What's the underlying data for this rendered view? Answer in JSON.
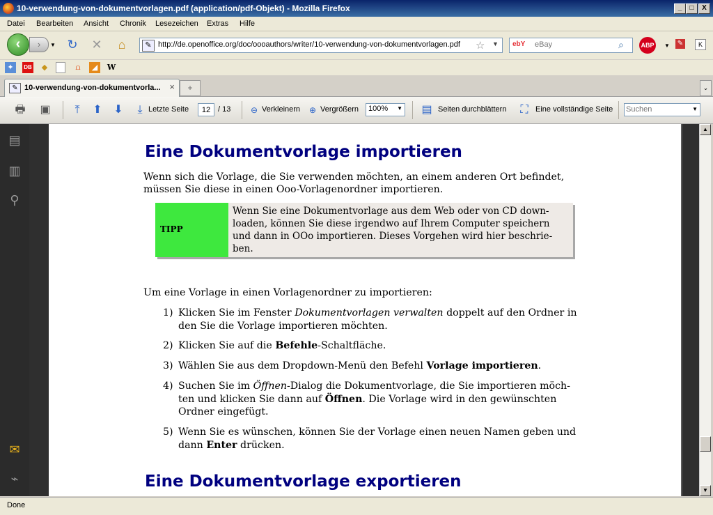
{
  "window": {
    "title": "10-verwendung-von-dokumentvorlagen.pdf (application/pdf-Objekt) - Mozilla Firefox",
    "controls": [
      "_",
      "□",
      "X"
    ]
  },
  "menu": [
    "Datei",
    "Bearbeiten",
    "Ansicht",
    "Chronik",
    "Lesezeichen",
    "Extras",
    "Hilfe"
  ],
  "nav": {
    "url": "http://de.openoffice.org/doc/oooauthors/writer/10-verwendung-von-dokumentvorlagen.pdf",
    "search_engine": "ebY",
    "search_placeholder": "eBay",
    "abp_label": "ABP"
  },
  "tabs": {
    "active_label": "10-verwendung-von-dokumentvorla...",
    "close": "×",
    "new_tab": "+"
  },
  "pdf_toolbar": {
    "last_page": "Letzte Seite",
    "current_page": "12",
    "total_pages": "/ 13",
    "zoom_out": "Verkleinern",
    "zoom_in": "Vergrößern",
    "zoom_value": "100%",
    "browse_pages": "Seiten durchblättern",
    "full_page": "Eine vollständige Seite",
    "search_placeholder": "Suchen"
  },
  "document": {
    "heading1": "Eine Dokumentvorlage importieren",
    "intro_line1": "Wenn sich die Vorlage, die Sie verwenden möchten, an einem anderen Ort befindet,",
    "intro_line2": "müssen Sie diese in einen Ooo-Vorlagenordner importieren.",
    "tip_label": "TIPP",
    "tip_line1": "Wenn Sie eine Dokumentvorlage aus dem Web oder von CD down-",
    "tip_line2": "loaden, können Sie diese irgendwo auf Ihrem Computer speichern",
    "tip_line3": "und dann in OOo importieren. Dieses Vorgehen wird hier beschrie-",
    "tip_line4": "ben.",
    "steps_intro": "Um eine Vorlage in einen Vorlagenordner zu importieren:",
    "steps": [
      {
        "num": "1)",
        "a": "Klicken Sie im Fenster ",
        "em": "Dokumentvorlagen verwalten",
        "b": " doppelt auf den Ordner in",
        "line2": "den Sie die Vorlage importieren möchten."
      },
      {
        "num": "2)",
        "a": "Klicken Sie auf die ",
        "strong": "Befehle",
        "b": "-Schaltfläche."
      },
      {
        "num": "3)",
        "a": "Wählen Sie aus dem Dropdown-Menü den Befehl ",
        "strong": "Vorlage importieren",
        "b": "."
      },
      {
        "num": "4)",
        "a": "Suchen Sie im ",
        "em": "Öffnen",
        "b": "-Dialog die Dokumentvorlage, die Sie importieren möch-",
        "line2a": "ten und klicken Sie dann auf ",
        "line2strong": "Öffnen",
        "line2b": ". Die Vorlage wird in den gewünschten",
        "line3": "Ordner eingefügt."
      },
      {
        "num": "5)",
        "a": "Wenn Sie es wünschen, können Sie der Vorlage einen neuen Namen geben und",
        "line2a": "dann ",
        "line2strong": "Enter",
        "line2b": " drücken."
      }
    ],
    "heading2": "Eine Dokumentvorlage exportieren"
  },
  "status": "Done"
}
